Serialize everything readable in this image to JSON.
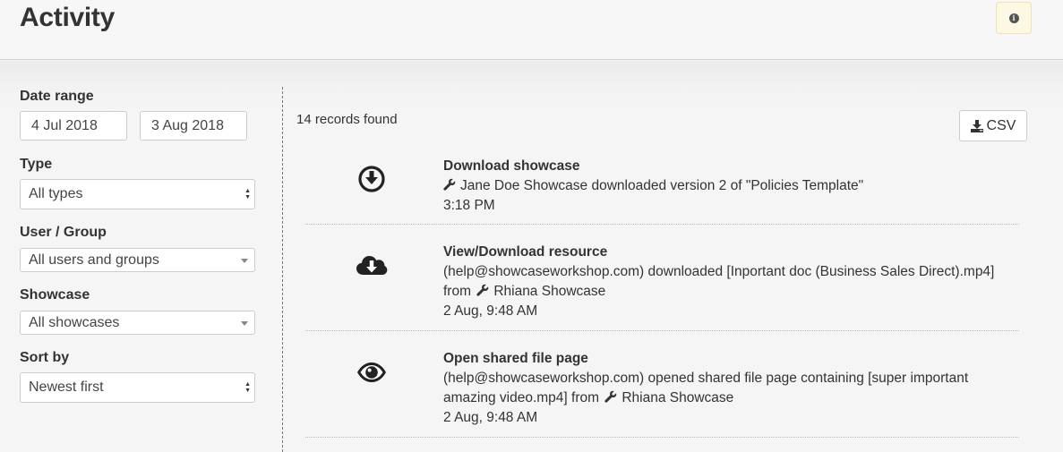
{
  "header": {
    "title": "Activity",
    "info_icon": "i"
  },
  "sidebar": {
    "date_range_label": "Date range",
    "date_from": "4 Jul 2018",
    "date_to": "3 Aug 2018",
    "type_label": "Type",
    "type_value": "All types",
    "user_group_label": "User / Group",
    "user_group_value": "All users and groups",
    "showcase_label": "Showcase",
    "showcase_value": "All showcases",
    "sort_label": "Sort by",
    "sort_value": "Newest first"
  },
  "main": {
    "records_found": "14 records found",
    "csv_label": "CSV",
    "items": [
      {
        "icon": "download-circle-icon",
        "title": "Download showcase",
        "line1_a": "",
        "line1_b": "Jane Doe Showcase downloaded version 2 of \"Policies Template\"",
        "time": "3:18 PM"
      },
      {
        "icon": "cloud-download-icon",
        "title": "View/Download resource",
        "line1": "(help@showcaseworkshop.com) downloaded [Inportant doc (Business Sales Direct).mp4]",
        "line2_a": "from",
        "line2_b": "Rhiana Showcase",
        "time": "2 Aug, 9:48 AM"
      },
      {
        "icon": "eye-icon",
        "title": "Open shared file page",
        "line1": "(help@showcaseworkshop.com) opened shared file page containing [super important",
        "line2_a": "amazing video.mp4] from",
        "line2_b": "Rhiana Showcase",
        "time": "2 Aug, 9:48 AM"
      }
    ]
  }
}
